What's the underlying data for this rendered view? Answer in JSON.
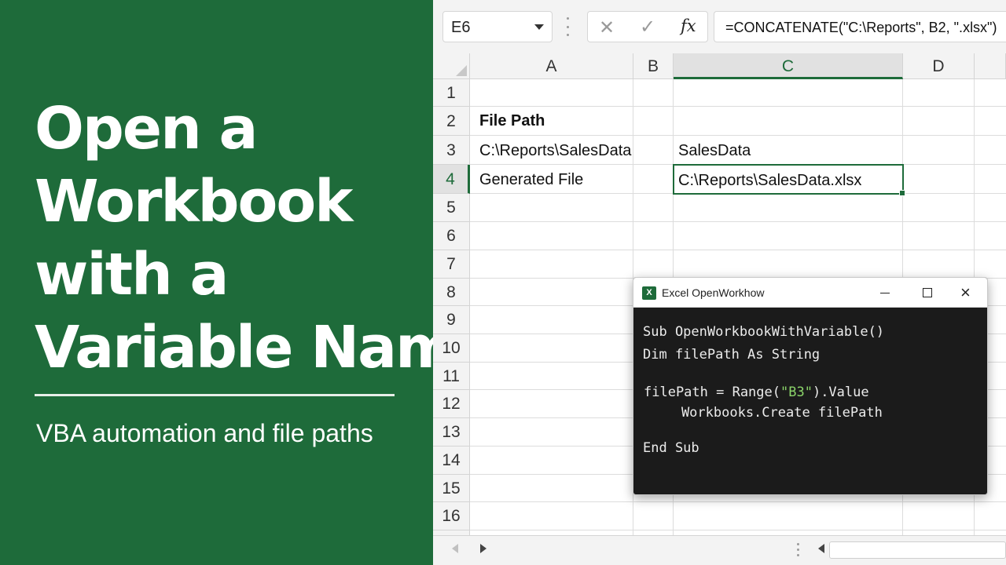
{
  "headline": {
    "lines": [
      "Open a",
      "Workbook",
      "with a",
      "Variable Name"
    ],
    "subtitle": "VBA automation and file paths"
  },
  "formula_bar": {
    "name_box": "E6",
    "cancel_icon": "✕",
    "enter_icon": "✓",
    "fx_label": "fx",
    "formula": "=CONCATENATE(\"C:\\Reports\", B2, \".xlsx\")"
  },
  "grid": {
    "columns": [
      "A",
      "B",
      "C",
      "D"
    ],
    "active_column": "C",
    "rows": [
      "1",
      "2",
      "3",
      "4",
      "5",
      "6",
      "7",
      "8",
      "9",
      "10",
      "11",
      "12",
      "13",
      "14",
      "15",
      "16"
    ],
    "active_row": "4",
    "cells": {
      "A2": "File Path",
      "A3": "C:\\Reports\\SalesData",
      "A4": "Generated File",
      "C3": "SalesData",
      "C4": "C:\\Reports\\SalesData.xlsx"
    }
  },
  "vba_window": {
    "title": "Excel OpenWorkhow",
    "logo_letter": "X",
    "minimize_icon": "minimize-icon",
    "maximize_icon": "maximize-icon",
    "close_icon": "×",
    "code": {
      "line1": "Sub OpenWorkbookWithVariable()",
      "line2": "Dim filePath As String",
      "line3_a": "filePath = Range(",
      "line3_str": "\"B3\"",
      "line3_b": ").Value",
      "line4": "    Workbooks.Create filePath",
      "line5": "End Sub"
    }
  },
  "colors": {
    "brand_green": "#1e6b3a",
    "code_bg": "#1b1b1b",
    "string_green": "#8bd46a"
  }
}
